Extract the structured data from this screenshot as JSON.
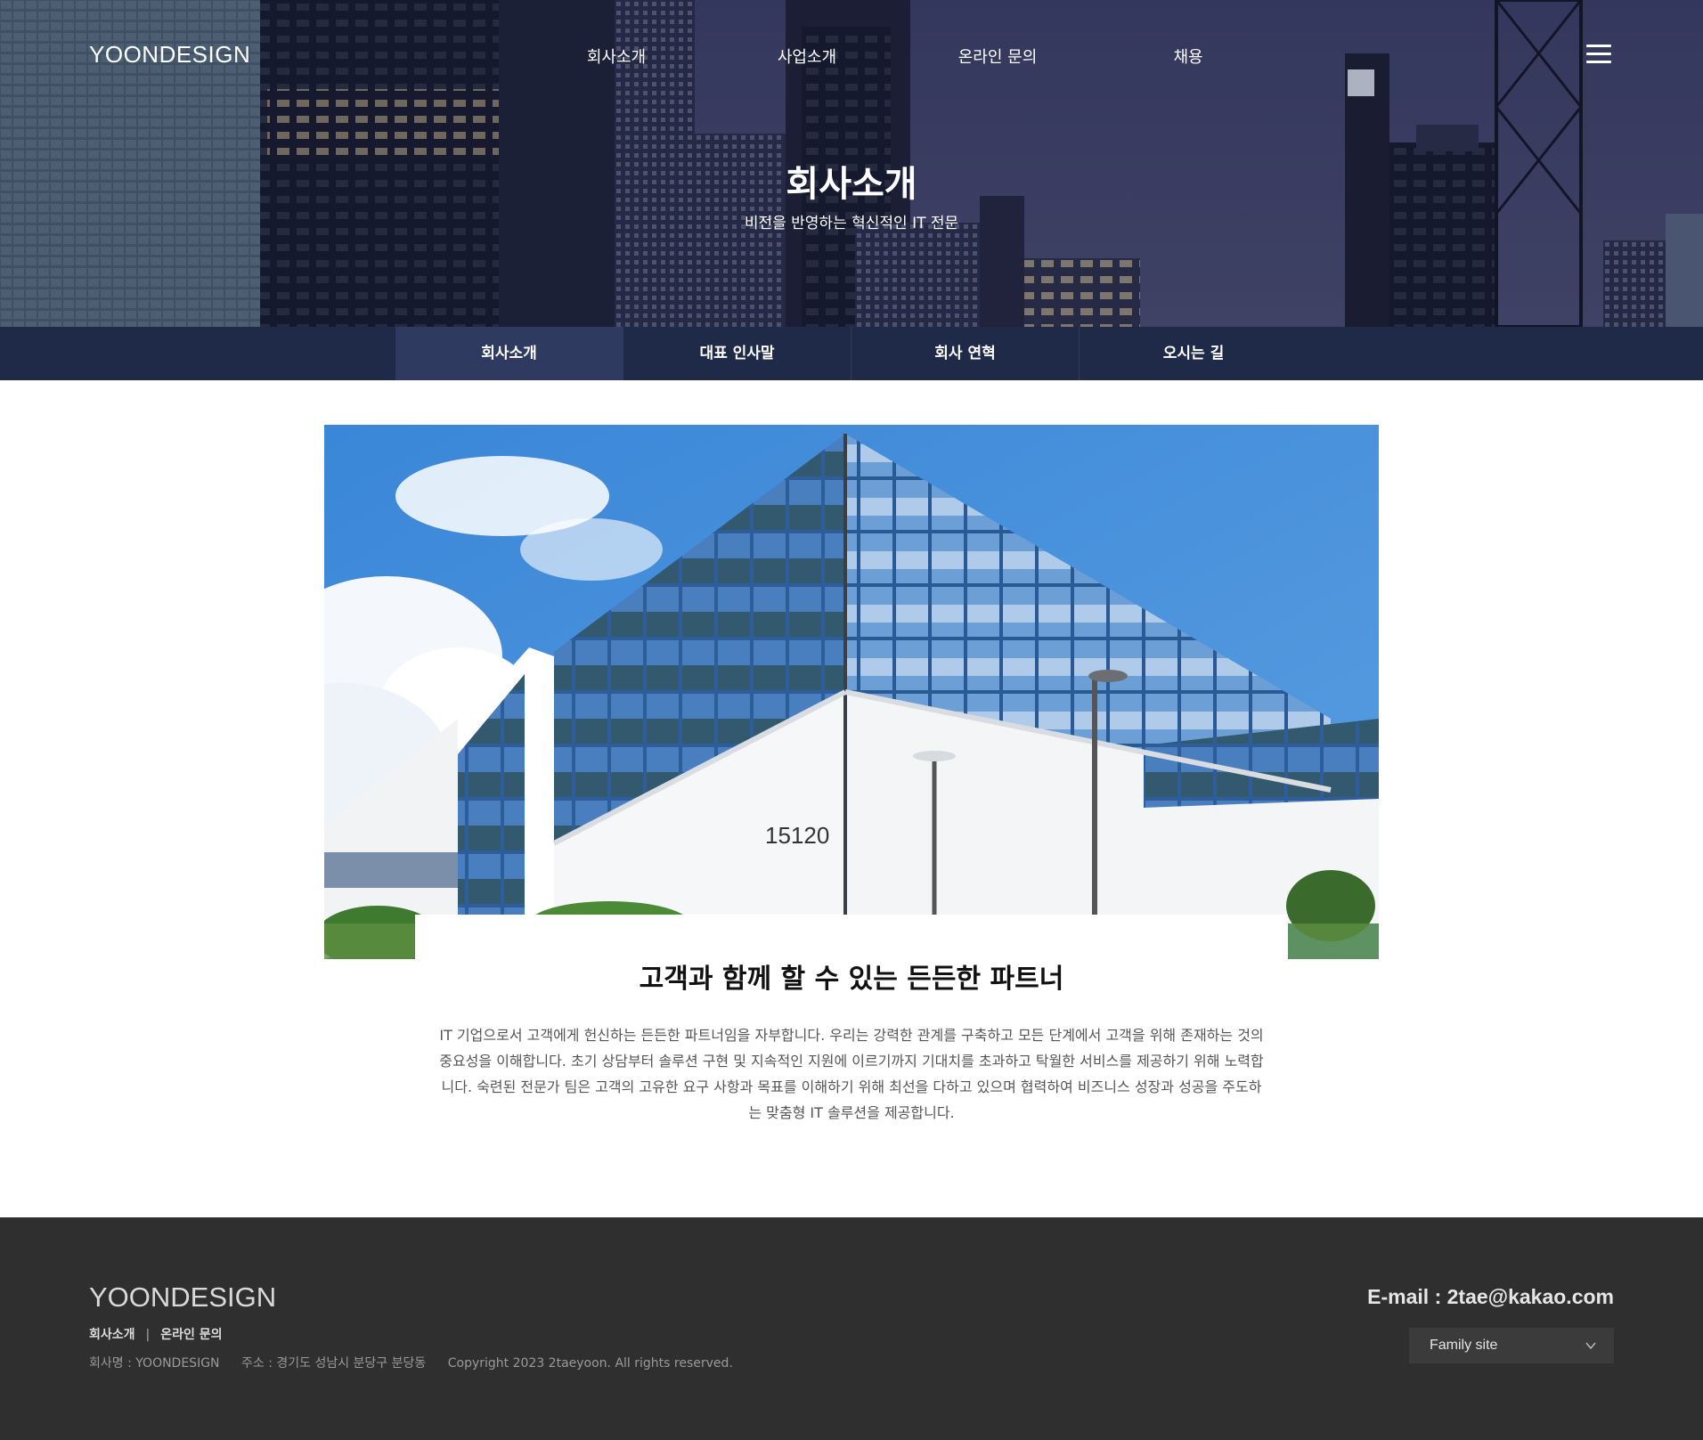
{
  "header": {
    "logo": "YOONDESIGN",
    "nav": [
      "회사소개",
      "사업소개",
      "온라인 문의",
      "채용"
    ],
    "menu_icon": "hamburger-menu-icon"
  },
  "hero": {
    "title": "회사소개",
    "subtitle": "비전을 반영하는 혁신적인 IT 전문"
  },
  "subnav": {
    "tabs": [
      "회사소개",
      "대표 인사말",
      "회사 연혁",
      "오시는 길"
    ],
    "active": "회사소개"
  },
  "main": {
    "building_number": "15120",
    "title": "고객과 함께 할 수 있는 든든한 파트너",
    "body": "IT 기업으로서 고객에게 헌신하는 든든한 파트너임을 자부합니다. 우리는 강력한 관계를 구축하고 모든 단계에서 고객을 위해 존재하는 것의 중요성을 이해합니다. 초기 상담부터 솔루션 구현 및 지속적인 지원에 이르기까지 기대치를 초과하고 탁월한 서비스를 제공하기 위해 노력합니다. 숙련된 전문가 팀은 고객의 고유한 요구 사항과 목표를 이해하기 위해 최선을 다하고 있으며 협력하여 비즈니스 성장과 성공을 주도하는 맞춤형 IT 솔루션을 제공합니다."
  },
  "footer": {
    "logo": "YOONDESIGN",
    "links": [
      "회사소개",
      "온라인 문의"
    ],
    "link_separator": "|",
    "company": "회사명 : YOONDESIGN",
    "address": "주소 : 경기도 성남시 분당구 분당동",
    "copyright": "Copyright 2023 2taeyoon. All rights reserved.",
    "email": "E-mail : 2tae@kakao.com",
    "family_site": "Family site"
  },
  "colors": {
    "subnav_bg": "#1f2948",
    "subnav_active": "#2e3a60",
    "footer_bg": "#2f2f2f"
  }
}
